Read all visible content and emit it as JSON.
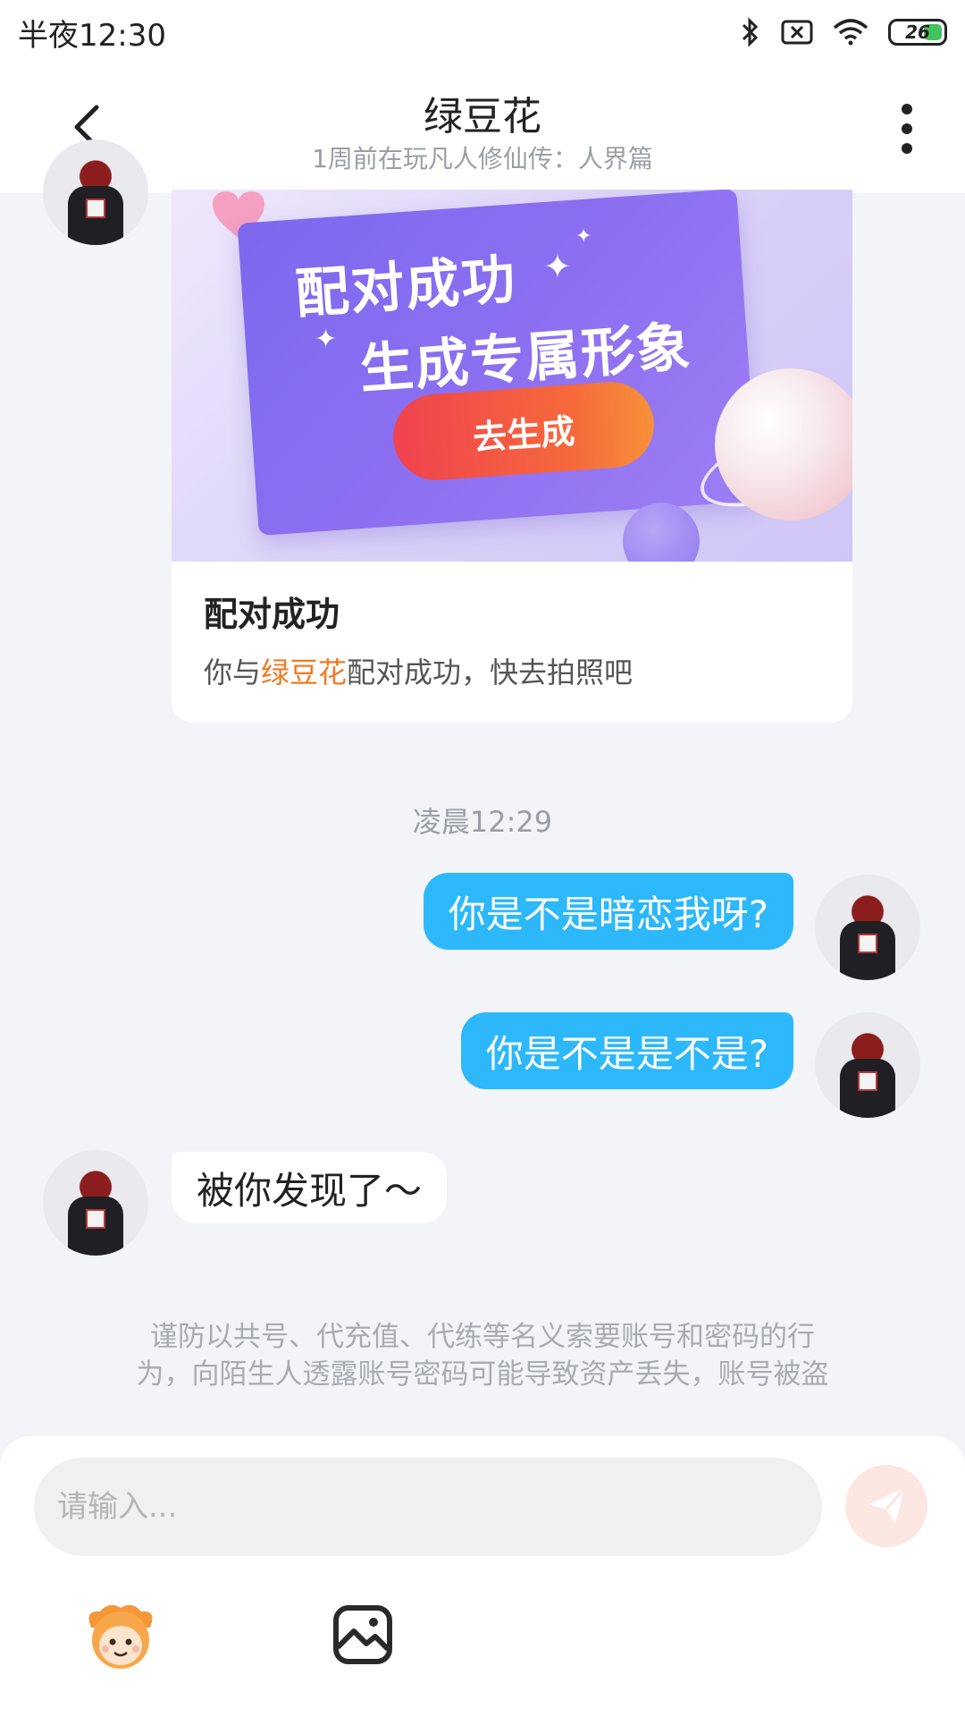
{
  "status_bar": {
    "time": "半夜12:30",
    "battery": "26",
    "icons": [
      "bluetooth-icon",
      "sim-off-icon",
      "wifi-icon",
      "battery-icon"
    ]
  },
  "header": {
    "title": "绿豆花",
    "subtitle": "1周前在玩凡人修仙传：人界篇",
    "back_icon": "chevron-left-icon",
    "more_icon": "more-vertical-icon"
  },
  "card": {
    "banner_line1": "配对成功",
    "banner_line2": "生成专属形象",
    "banner_button": "去生成",
    "title": "配对成功",
    "desc_prefix": "你与",
    "desc_name": "绿豆花",
    "desc_suffix": "配对成功，快去拍照吧"
  },
  "messages": {
    "timestamp": "凌晨12:29",
    "out1": "你是不是暗恋我呀?",
    "out2": "你是不是是不是?",
    "in1": "被你发现了～"
  },
  "warning": {
    "line1": "谨防以共号、代充值、代练等名义索要账号和密码的行",
    "line2": "为，向陌生人透露账号密码可能导致资产丢失，账号被盗"
  },
  "input": {
    "placeholder": "请输入..."
  },
  "colors": {
    "accent_blue": "#2cb8fa",
    "highlight_orange": "#f07a22",
    "banner_purple": "#8c6ff1",
    "send_button_bg": "#fbe6e2"
  }
}
